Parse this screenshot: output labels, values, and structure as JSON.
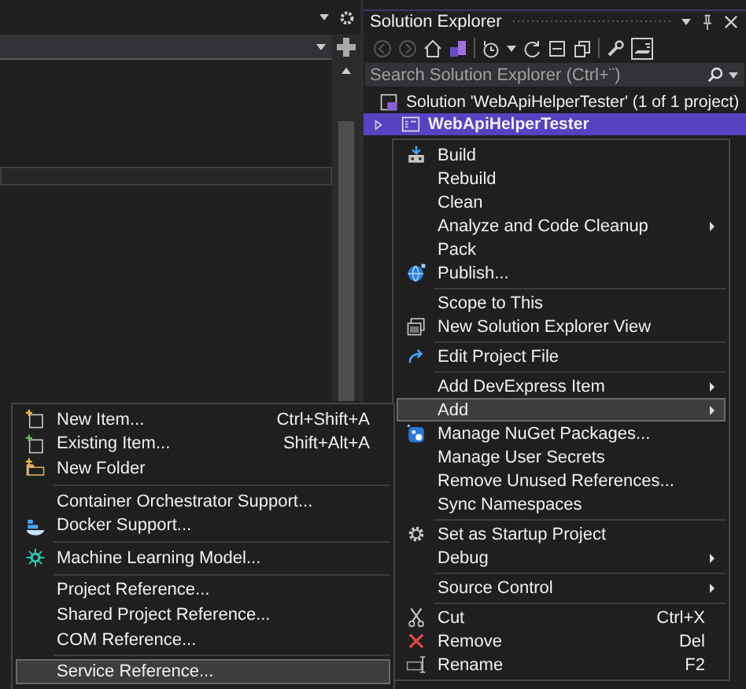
{
  "solution_explorer": {
    "title": "Solution Explorer",
    "search": {
      "placeholder": "Search Solution Explorer (Ctrl+¨)"
    },
    "tree": [
      {
        "label": "Solution 'WebApiHelperTester' (1 of 1 project)",
        "kind": "solution",
        "selected": false,
        "children": [
          {
            "label": "WebApiHelperTester",
            "kind": "project",
            "selected": true,
            "expanded": false
          }
        ]
      }
    ]
  },
  "context_menu": {
    "items": [
      {
        "kind": "item",
        "label": "Build",
        "has_submenu": false,
        "selected": false
      },
      {
        "kind": "item",
        "label": "Rebuild",
        "has_submenu": false,
        "selected": false
      },
      {
        "kind": "item",
        "label": "Clean",
        "has_submenu": false,
        "selected": false
      },
      {
        "kind": "item",
        "label": "Analyze and Code Cleanup",
        "has_submenu": true,
        "selected": false
      },
      {
        "kind": "item",
        "label": "Pack",
        "has_submenu": false,
        "selected": false
      },
      {
        "kind": "item",
        "label": "Publish...",
        "has_submenu": false,
        "selected": false
      },
      {
        "kind": "separator"
      },
      {
        "kind": "item",
        "label": "Scope to This",
        "has_submenu": false,
        "selected": false
      },
      {
        "kind": "item",
        "label": "New Solution Explorer View",
        "has_submenu": false,
        "selected": false
      },
      {
        "kind": "separator"
      },
      {
        "kind": "item",
        "label": "Edit Project File",
        "has_submenu": false,
        "selected": false
      },
      {
        "kind": "separator"
      },
      {
        "kind": "item",
        "label": "Add DevExpress Item",
        "has_submenu": true,
        "selected": false
      },
      {
        "kind": "item",
        "label": "Add",
        "has_submenu": true,
        "selected": true
      },
      {
        "kind": "item",
        "label": "Manage NuGet Packages...",
        "has_submenu": false,
        "selected": false
      },
      {
        "kind": "item",
        "label": "Manage User Secrets",
        "has_submenu": false,
        "selected": false
      },
      {
        "kind": "item",
        "label": "Remove Unused References...",
        "has_submenu": false,
        "selected": false
      },
      {
        "kind": "item",
        "label": "Sync Namespaces",
        "has_submenu": false,
        "selected": false
      },
      {
        "kind": "separator"
      },
      {
        "kind": "item",
        "label": "Set as Startup Project",
        "has_submenu": false,
        "selected": false
      },
      {
        "kind": "item",
        "label": "Debug",
        "has_submenu": true,
        "selected": false
      },
      {
        "kind": "separator"
      },
      {
        "kind": "item",
        "label": "Source Control",
        "has_submenu": true,
        "selected": false
      },
      {
        "kind": "separator"
      },
      {
        "kind": "item",
        "label": "Cut",
        "shortcut": "Ctrl+X",
        "has_submenu": false,
        "selected": false
      },
      {
        "kind": "item",
        "label": "Remove",
        "shortcut": "Del",
        "has_submenu": false,
        "selected": false
      },
      {
        "kind": "item",
        "label": "Rename",
        "shortcut": "F2",
        "has_submenu": false,
        "selected": false
      }
    ]
  },
  "add_submenu": {
    "items": [
      {
        "kind": "item",
        "label": "New Item...",
        "shortcut": "Ctrl+Shift+A",
        "selected": false
      },
      {
        "kind": "item",
        "label": "Existing Item...",
        "shortcut": "Shift+Alt+A",
        "selected": false
      },
      {
        "kind": "item",
        "label": "New Folder",
        "selected": false
      },
      {
        "kind": "separator"
      },
      {
        "kind": "item",
        "label": "Container Orchestrator Support...",
        "selected": false
      },
      {
        "kind": "item",
        "label": "Docker Support...",
        "selected": false
      },
      {
        "kind": "separator"
      },
      {
        "kind": "item",
        "label": "Machine Learning Model...",
        "selected": false
      },
      {
        "kind": "separator"
      },
      {
        "kind": "item",
        "label": "Project Reference...",
        "selected": false
      },
      {
        "kind": "item",
        "label": "Shared Project Reference...",
        "selected": false
      },
      {
        "kind": "item",
        "label": "COM Reference...",
        "selected": false
      },
      {
        "kind": "separator"
      },
      {
        "kind": "item",
        "label": "Service Reference...",
        "selected": true
      }
    ]
  }
}
